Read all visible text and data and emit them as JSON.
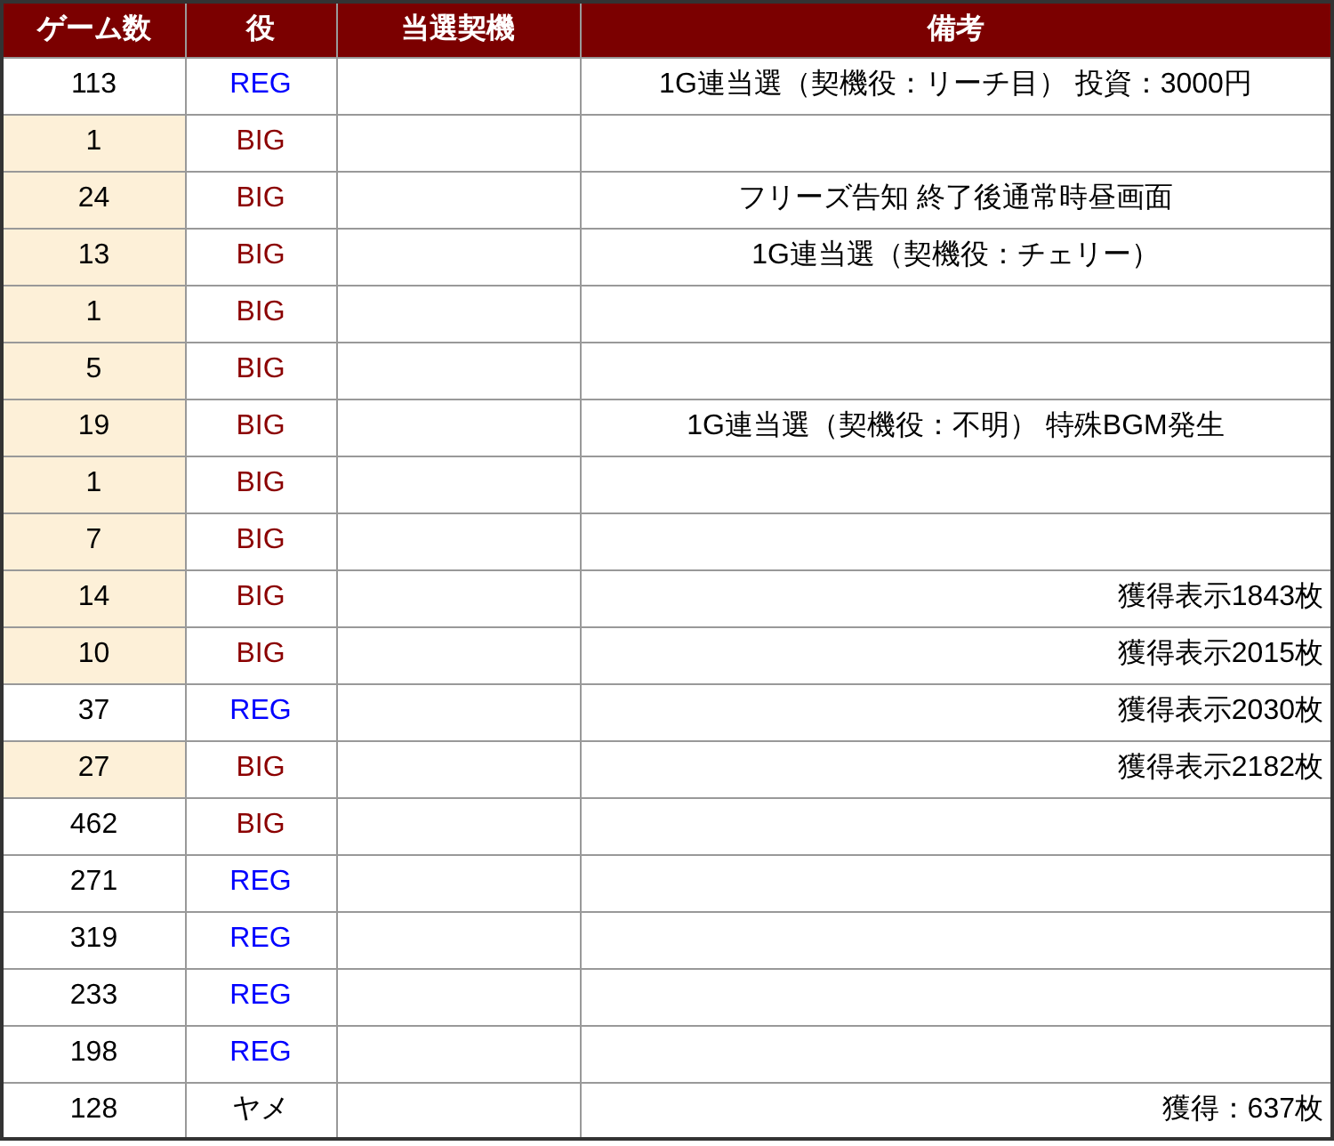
{
  "columns": [
    "ゲーム数",
    "役",
    "当選契機",
    "備考"
  ],
  "rows": [
    {
      "games": "113",
      "highlighted": false,
      "role": {
        "text": "REG",
        "kind": "reg"
      },
      "note": {
        "text": "1G連当選（契機役：リーチ目） 投資：3000円",
        "kind": "comment"
      }
    },
    {
      "games": "1",
      "highlighted": true,
      "role": {
        "text": "BIG",
        "kind": "big"
      }
    },
    {
      "games": "24",
      "highlighted": true,
      "role": {
        "text": "BIG",
        "kind": "big"
      },
      "note": {
        "text": "フリーズ告知 終了後通常時昼画面",
        "kind": "comment"
      }
    },
    {
      "games": "13",
      "highlighted": true,
      "role": {
        "text": "BIG",
        "kind": "big"
      },
      "note": {
        "text": "1G連当選（契機役：チェリー）",
        "kind": "comment"
      }
    },
    {
      "games": "1",
      "highlighted": true,
      "role": {
        "text": "BIG",
        "kind": "big"
      }
    },
    {
      "games": "5",
      "highlighted": true,
      "role": {
        "text": "BIG",
        "kind": "big"
      }
    },
    {
      "games": "19",
      "highlighted": true,
      "role": {
        "text": "BIG",
        "kind": "big"
      },
      "note": {
        "text": "1G連当選（契機役：不明） 特殊BGM発生",
        "kind": "comment"
      }
    },
    {
      "games": "1",
      "highlighted": true,
      "role": {
        "text": "BIG",
        "kind": "big"
      }
    },
    {
      "games": "7",
      "highlighted": true,
      "role": {
        "text": "BIG",
        "kind": "big"
      }
    },
    {
      "games": "14",
      "highlighted": true,
      "role": {
        "text": "BIG",
        "kind": "big"
      },
      "note": {
        "text": "獲得表示1843枚",
        "kind": "tally"
      }
    },
    {
      "games": "10",
      "highlighted": true,
      "role": {
        "text": "BIG",
        "kind": "big"
      },
      "note": {
        "text": "獲得表示2015枚",
        "kind": "tally"
      }
    },
    {
      "games": "37",
      "highlighted": false,
      "role": {
        "text": "REG",
        "kind": "reg"
      },
      "note": {
        "text": "獲得表示2030枚",
        "kind": "tally"
      }
    },
    {
      "games": "27",
      "highlighted": true,
      "role": {
        "text": "BIG",
        "kind": "big"
      },
      "note": {
        "text": "獲得表示2182枚",
        "kind": "tally"
      }
    },
    {
      "games": "462",
      "highlighted": false,
      "role": {
        "text": "BIG",
        "kind": "big"
      }
    },
    {
      "games": "271",
      "highlighted": false,
      "role": {
        "text": "REG",
        "kind": "reg"
      }
    },
    {
      "games": "319",
      "highlighted": false,
      "role": {
        "text": "REG",
        "kind": "reg"
      }
    },
    {
      "games": "233",
      "highlighted": false,
      "role": {
        "text": "REG",
        "kind": "reg"
      }
    },
    {
      "games": "198",
      "highlighted": false,
      "role": {
        "text": "REG",
        "kind": "reg"
      }
    },
    {
      "games": "128",
      "highlighted": false,
      "role": {
        "text": "ヤメ",
        "kind": "quit"
      },
      "note": {
        "text": "獲得：637枚",
        "kind": "tally"
      }
    }
  ]
}
